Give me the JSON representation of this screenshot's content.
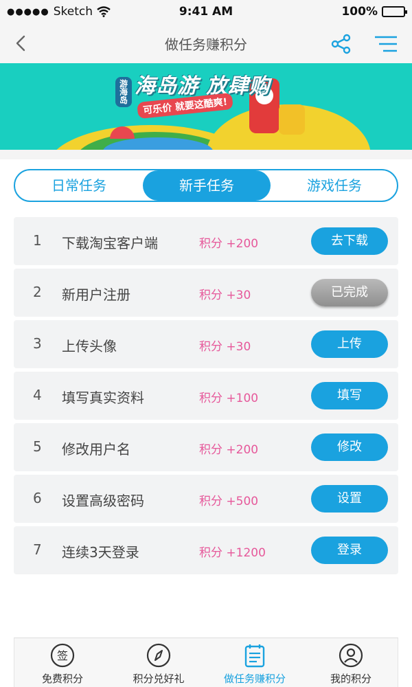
{
  "status_bar": {
    "signal": "●●●●●",
    "carrier": "Sketch",
    "time": "9:41 AM",
    "battery": "100%"
  },
  "nav": {
    "title": "做任务赚积分"
  },
  "banner": {
    "tag": "游海岛",
    "title": "海岛游 放肆购",
    "subtitle": "可乐价 就要这酷爽!"
  },
  "tabs": [
    {
      "label": "日常任务",
      "active": false
    },
    {
      "label": "新手任务",
      "active": true
    },
    {
      "label": "游戏任务",
      "active": false
    }
  ],
  "tasks": [
    {
      "num": "1",
      "name": "下载淘宝客户端",
      "points": "积分 +200",
      "action": "去下载",
      "done": false
    },
    {
      "num": "2",
      "name": "新用户注册",
      "points": "积分 +30",
      "action": "已完成",
      "done": true
    },
    {
      "num": "3",
      "name": "上传头像",
      "points": "积分 +30",
      "action": "上传",
      "done": false
    },
    {
      "num": "4",
      "name": "填写真实资料",
      "points": "积分 +100",
      "action": "填写",
      "done": false
    },
    {
      "num": "5",
      "name": "修改用户名",
      "points": "积分 +200",
      "action": "修改",
      "done": false
    },
    {
      "num": "6",
      "name": "设置高级密码",
      "points": "积分 +500",
      "action": "设置",
      "done": false
    },
    {
      "num": "7",
      "name": "连续3天登录",
      "points": "积分 +1200",
      "action": "登录",
      "done": false
    }
  ],
  "bottom_nav": [
    {
      "label": "免费积分",
      "icon": "sign-in-icon",
      "glyph": "签"
    },
    {
      "label": "积分兑好礼",
      "icon": "compass-icon"
    },
    {
      "label": "做任务赚积分",
      "icon": "task-list-icon",
      "active": true
    },
    {
      "label": "我的积分",
      "icon": "user-icon"
    }
  ],
  "colors": {
    "accent": "#1aa2df",
    "points": "#e6589a",
    "banner": "#19cfc0",
    "done_button": "#9a9a9a"
  }
}
